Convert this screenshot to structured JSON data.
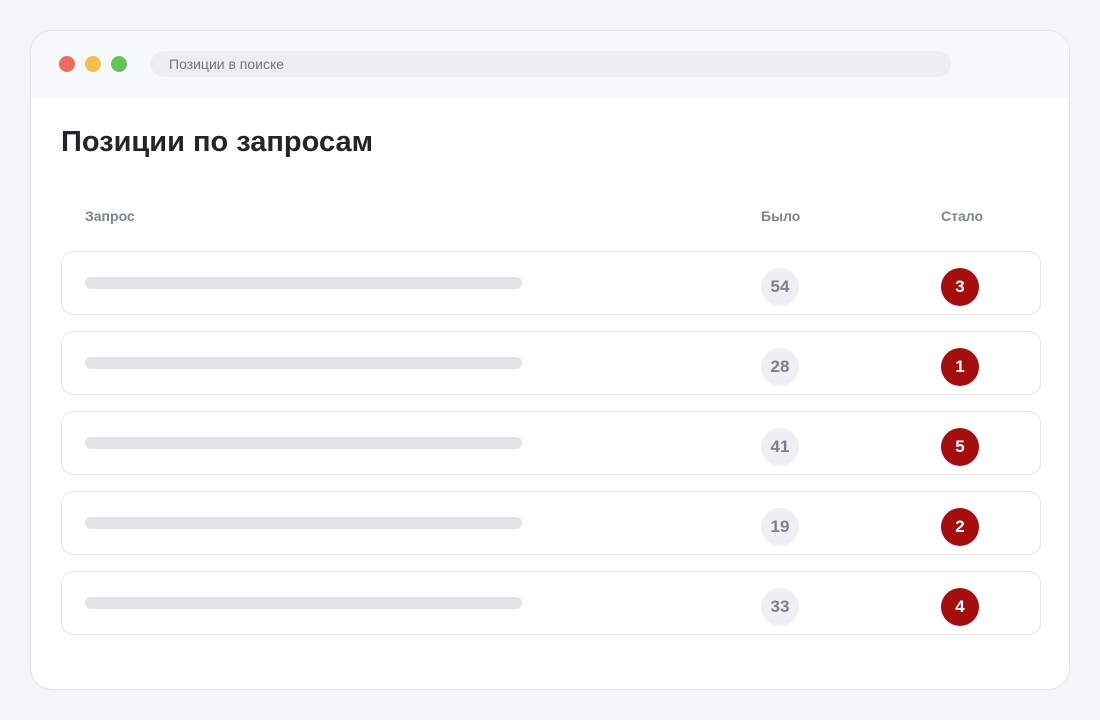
{
  "window": {
    "address": "Позиции в поиске",
    "controls": {
      "close_color": "#ed6a5e",
      "minimize_color": "#f5bf4f",
      "maximize_color": "#62c554"
    }
  },
  "page": {
    "title": "Позиции по запросам"
  },
  "table": {
    "headers": {
      "query": "Запрос",
      "before": "Было",
      "after": "Стало"
    },
    "rows": [
      {
        "before": "54",
        "after": "3"
      },
      {
        "before": "28",
        "after": "1"
      },
      {
        "before": "41",
        "after": "5"
      },
      {
        "before": "19",
        "after": "2"
      },
      {
        "before": "33",
        "after": "4"
      }
    ]
  },
  "colors": {
    "accent": "#a50e0e",
    "before_badge_bg": "#eef0f3",
    "placeholder_bar": "#e0e3e8"
  }
}
